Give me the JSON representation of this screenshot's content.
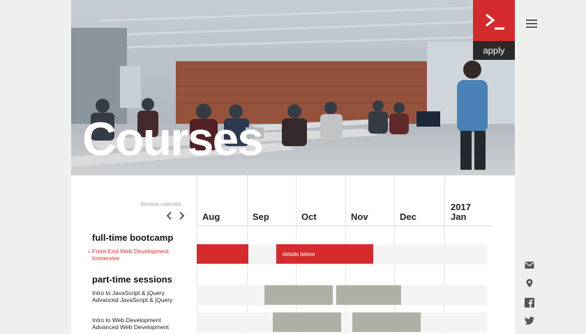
{
  "hero": {
    "title": "Courses",
    "apply_label": "apply",
    "logo_glyph": "›_"
  },
  "calendar": {
    "browse_label": "browse calendar",
    "months": [
      "Aug",
      "Sep",
      "Oct",
      "Nov",
      "Dec",
      "Jan"
    ],
    "year_label": "2017"
  },
  "fulltime": {
    "title": "full-time bootcamp",
    "course_line1": "Front-End Web Development",
    "course_line2": "Immersive",
    "bar_label": "details below"
  },
  "parttime": {
    "title": "part-time sessions",
    "group1_line1": "Intro to JavaScript & jQuery",
    "group1_line2": "Advanced JavaScript & jQuery",
    "group2_line1": "Intro to Web Development",
    "group2_line2": "Advanced Web Development"
  },
  "colors": {
    "accent_red": "#d52b2e",
    "bar_gray": "#aeb0a6",
    "badge_dark": "#2a2a2a"
  },
  "icons": [
    "menu-icon",
    "mail-icon",
    "location-icon",
    "facebook-icon",
    "twitter-icon",
    "chevron-left-icon",
    "chevron-right-icon",
    "terminal-logo-icon"
  ]
}
